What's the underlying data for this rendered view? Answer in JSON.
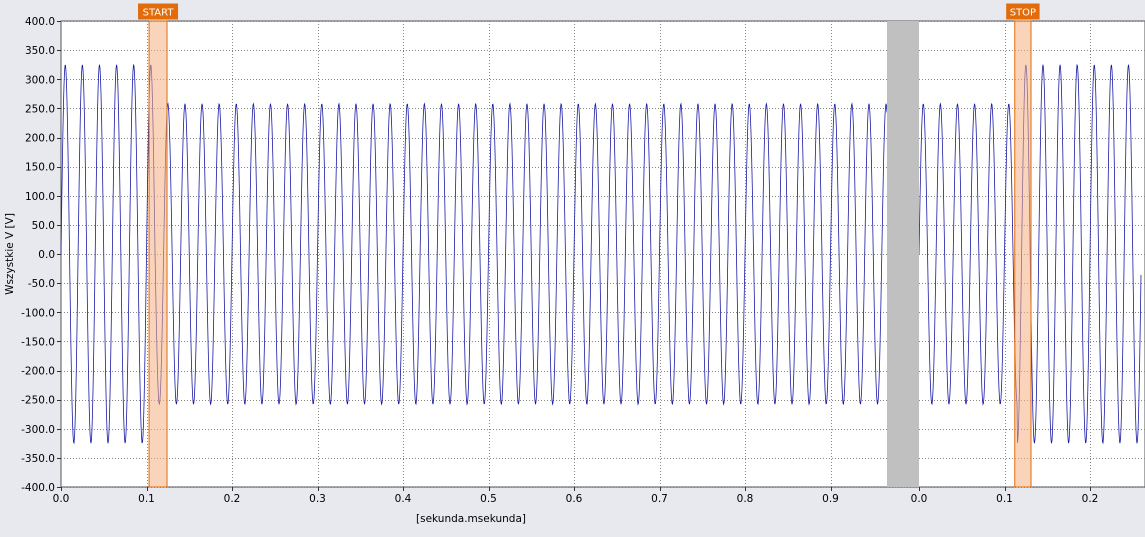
{
  "chart_data": {
    "type": "line",
    "ylabel": "Wszystkie V [V]",
    "xlabel": "[sekunda.msekunda]",
    "ylim": [
      -400,
      400
    ],
    "y_ticks": [
      400,
      350,
      300,
      250,
      200,
      150,
      100,
      50,
      0,
      -50,
      -100,
      -150,
      -200,
      -250,
      -300,
      -350,
      -400
    ],
    "x_ticks_segment1": [
      0.0,
      0.1,
      0.2,
      0.3,
      0.4,
      0.5,
      0.6,
      0.7,
      0.8,
      0.9
    ],
    "x_ticks_segment2": [
      0.0,
      0.1,
      0.2
    ],
    "grid": true,
    "segments": [
      {
        "x_start": 0.0,
        "x_end": 0.97
      },
      {
        "x_start": 0.0,
        "x_end": 0.26
      }
    ],
    "series": [
      {
        "frequency_hz": 50,
        "envelope": [
          {
            "segment": 1,
            "x_from": 0.0,
            "x_to": 0.11,
            "amplitude": 325
          },
          {
            "segment": 1,
            "x_from": 0.11,
            "x_to": 0.97,
            "amplitude": 258
          },
          {
            "segment": 2,
            "x_from": 0.0,
            "x_to": 0.115,
            "amplitude": 258
          },
          {
            "segment": 2,
            "x_from": 0.115,
            "x_to": 0.26,
            "amplitude": 325
          }
        ]
      }
    ],
    "markers": [
      {
        "label": "START",
        "segment": 1,
        "x_from": 0.103,
        "x_to": 0.124
      },
      {
        "label": "STOP",
        "segment": 2,
        "x_from": 0.112,
        "x_to": 0.131
      }
    ],
    "colors": {
      "background": "#e8e8ef",
      "plot_background": "#ffffff",
      "series": "#1a1aa6",
      "marker_fill": "#f4b183",
      "marker_stroke": "#e26b0a",
      "marker_label_bg": "#e26b0a",
      "gap": "#c0c0c0",
      "grid": "#888888"
    }
  }
}
